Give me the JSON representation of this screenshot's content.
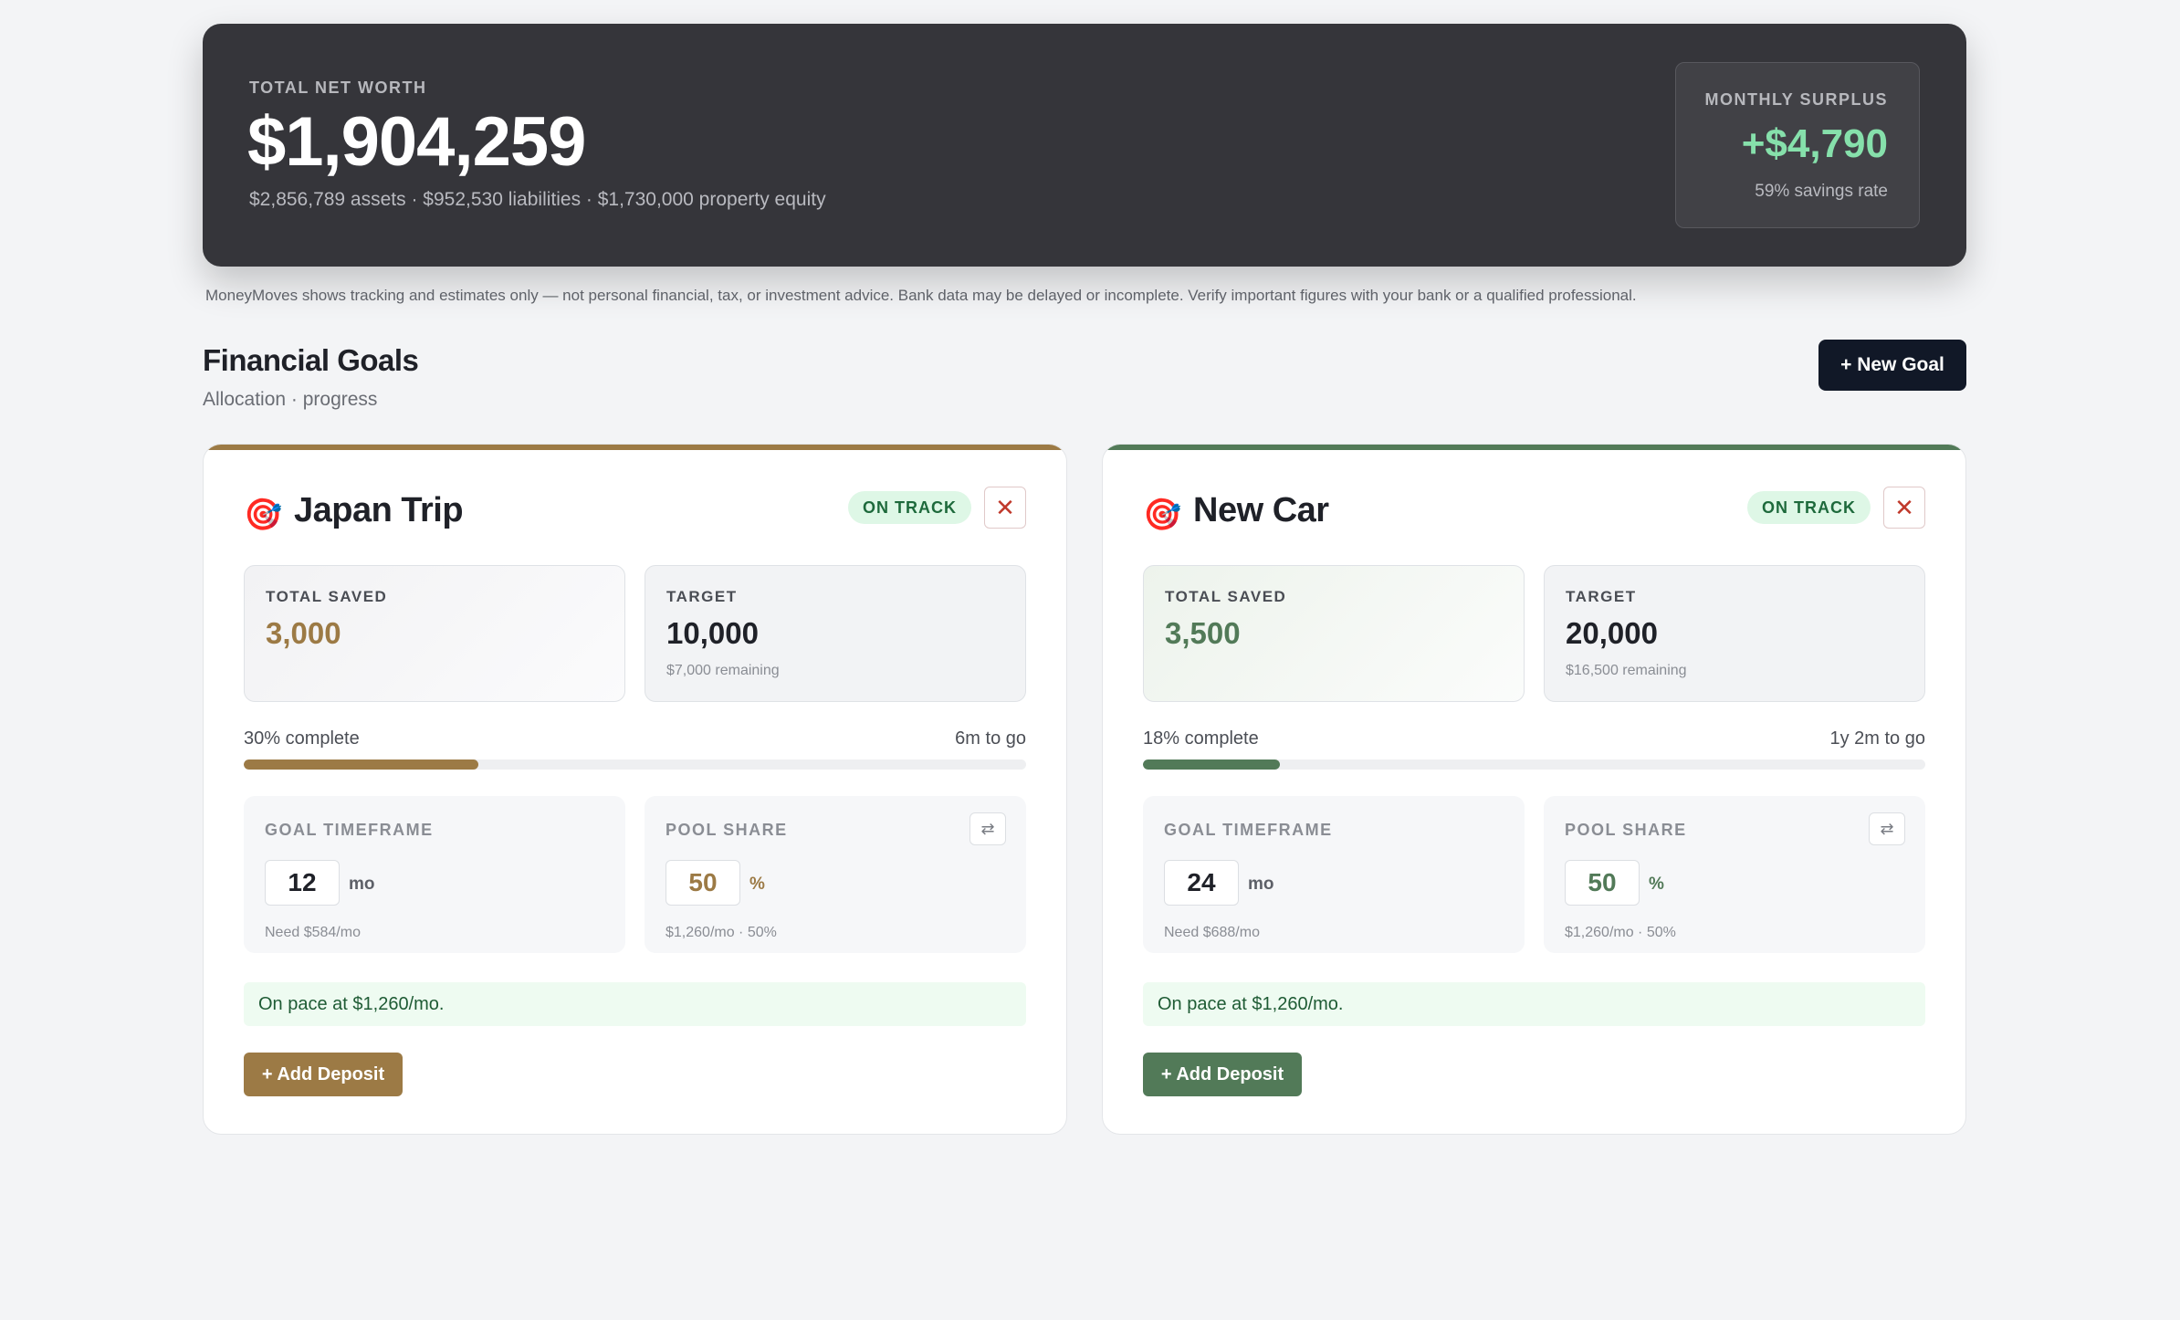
{
  "networth": {
    "label": "TOTAL NET WORTH",
    "value": "$1,904,259",
    "breakdown": "$2,856,789 assets · $952,530 liabilities · $1,730,000 property equity"
  },
  "surplus": {
    "label": "MONTHLY SURPLUS",
    "value": "+$4,790",
    "rate": "59% savings rate"
  },
  "disclaimer": "MoneyMoves shows tracking and estimates only — not personal financial, tax, or investment advice. Bank data may be delayed or incomplete. Verify important figures with your bank or a qualified professional.",
  "goals_section": {
    "title": "Financial Goals",
    "subtitle": "Allocation · progress",
    "new_goal_label": "+ New Goal"
  },
  "goals": [
    {
      "icon": "🎯",
      "name": "Japan Trip",
      "status": "ON TRACK",
      "accent": "#9c7a45",
      "saved_bg": "linear-gradient(135deg, #f2f2f4 0%, #fbfbfc 100%)",
      "saved_label": "TOTAL SAVED",
      "saved_value": "3,000",
      "target_label": "TARGET",
      "target_value": "10,000",
      "remaining": "$7,000 remaining",
      "percent_text": "30% complete",
      "progress": 0.3,
      "to_go": "6m to go",
      "timeframe_label": "GOAL TIMEFRAME",
      "timeframe_value": "12",
      "timeframe_unit": "mo",
      "timeframe_note": "Need $584/mo",
      "pool_label": "POOL SHARE",
      "pool_value": "50",
      "pool_unit": "%",
      "pool_note": "$1,260/mo · 50%",
      "pace": "On pace at $1,260/mo.",
      "deposit_label": "+ Add Deposit"
    },
    {
      "icon": "🎯",
      "name": "New Car",
      "status": "ON TRACK",
      "accent": "#527a58",
      "saved_bg": "linear-gradient(135deg, #edf3ec 0%, #fbfcfb 100%)",
      "saved_label": "TOTAL SAVED",
      "saved_value": "3,500",
      "target_label": "TARGET",
      "target_value": "20,000",
      "remaining": "$16,500 remaining",
      "percent_text": "18% complete",
      "progress": 0.175,
      "to_go": "1y 2m to go",
      "timeframe_label": "GOAL TIMEFRAME",
      "timeframe_value": "24",
      "timeframe_unit": "mo",
      "timeframe_note": "Need $688/mo",
      "pool_label": "POOL SHARE",
      "pool_value": "50",
      "pool_unit": "%",
      "pool_note": "$1,260/mo · 50%",
      "pace": "On pace at $1,260/mo.",
      "deposit_label": "+ Add Deposit"
    }
  ]
}
